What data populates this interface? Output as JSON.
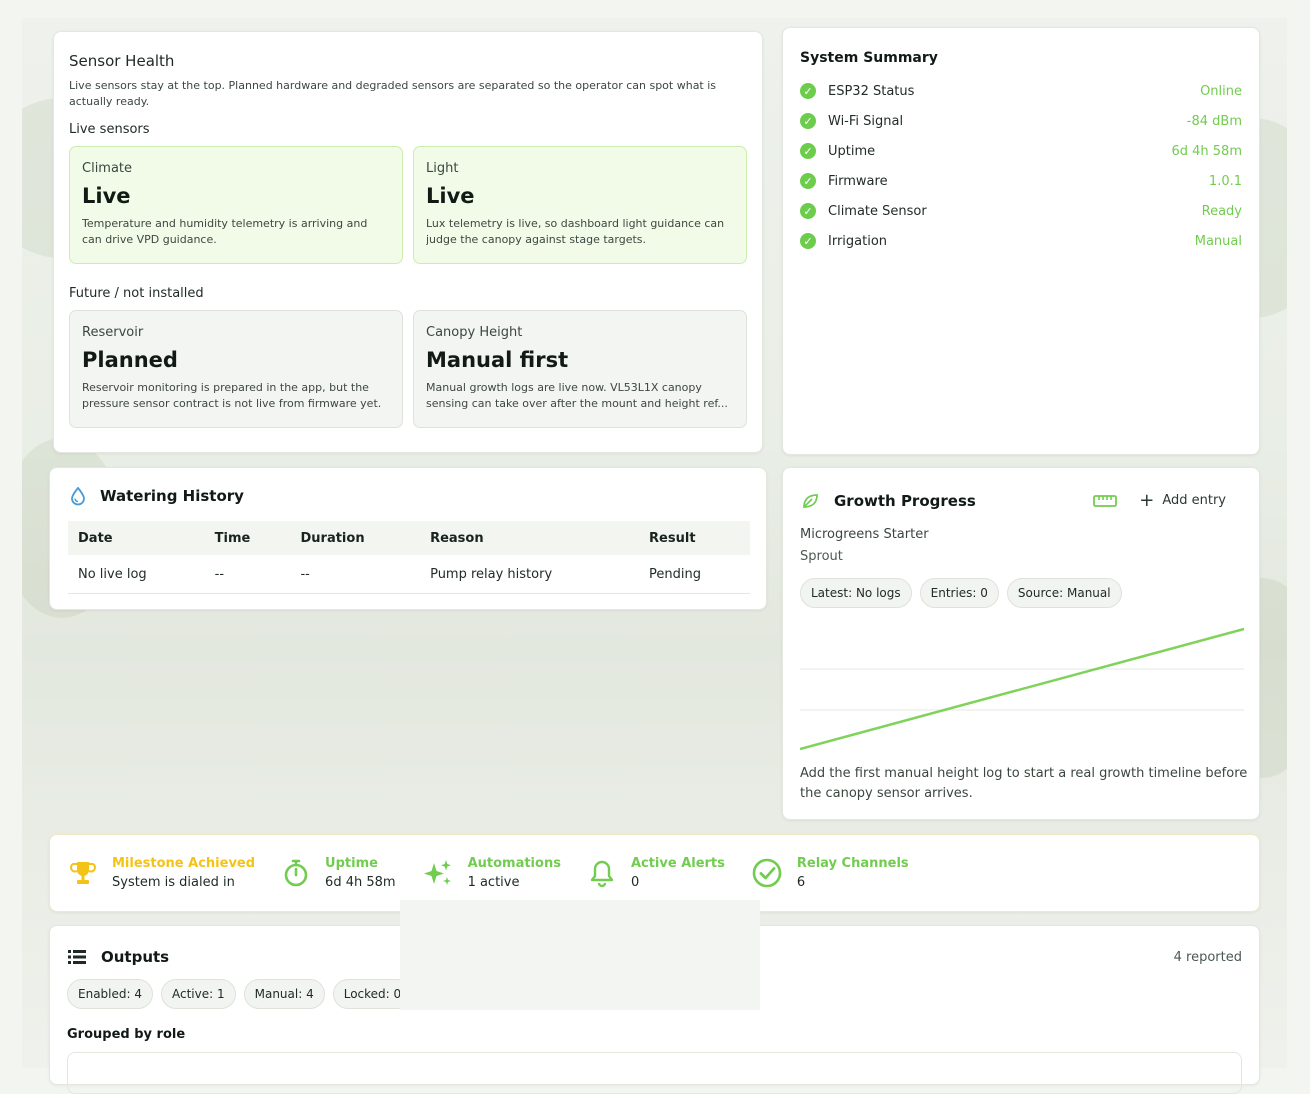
{
  "sensor_health": {
    "title": "Sensor Health",
    "description": "Live sensors stay at the top. Planned hardware and degraded sensors are separated so the operator can spot what is actually ready.",
    "live_label": "Live sensors",
    "future_label": "Future / not installed",
    "live": [
      {
        "name": "Climate",
        "status": "Live",
        "detail": "Temperature and humidity telemetry is arriving and can drive VPD guidance."
      },
      {
        "name": "Light",
        "status": "Live",
        "detail": "Lux telemetry is live, so dashboard light guidance can judge the canopy against stage targets."
      }
    ],
    "future": [
      {
        "name": "Reservoir",
        "status": "Planned",
        "detail": "Reservoir monitoring is prepared in the app, but the pressure sensor contract is not live from firmware yet."
      },
      {
        "name": "Canopy Height",
        "status": "Manual first",
        "detail": "Manual growth logs are live now. VL53L1X canopy sensing can take over after the mount and height ref..."
      }
    ]
  },
  "system_summary": {
    "title": "System Summary",
    "rows": [
      {
        "label": "ESP32 Status",
        "value": "Online"
      },
      {
        "label": "Wi-Fi Signal",
        "value": "-84 dBm"
      },
      {
        "label": "Uptime",
        "value": "6d 4h 58m"
      },
      {
        "label": "Firmware",
        "value": "1.0.1"
      },
      {
        "label": "Climate Sensor",
        "value": "Ready"
      },
      {
        "label": "Irrigation",
        "value": "Manual"
      }
    ]
  },
  "watering": {
    "title": "Watering History",
    "columns": [
      "Date",
      "Time",
      "Duration",
      "Reason",
      "Result"
    ],
    "rows": [
      [
        "No live log",
        "--",
        "--",
        "Pump relay history",
        "Pending"
      ]
    ]
  },
  "growth": {
    "title": "Growth Progress",
    "add_label": "Add entry",
    "plant": "Microgreens Starter",
    "stage": "Sprout",
    "pills": [
      "Latest: No logs",
      "Entries: 0",
      "Source: Manual"
    ],
    "note": "Add the first manual height log to start a real growth timeline before the canopy sensor arrives.",
    "line_color": "#7fd35a"
  },
  "chart_data": {
    "type": "line",
    "title": "",
    "xlabel": "",
    "ylabel": "",
    "grid": true,
    "x": [
      0,
      1
    ],
    "series": [
      {
        "values": [
          0,
          1
        ]
      }
    ],
    "ylim": [
      0,
      1
    ]
  },
  "stats": [
    {
      "label": "Milestone Achieved",
      "value": "System is dialed in",
      "color": "#f4c318",
      "icon": "trophy-icon"
    },
    {
      "label": "Uptime",
      "value": "6d 4h 58m",
      "color": "#72cc50",
      "icon": "stopwatch-icon"
    },
    {
      "label": "Automations",
      "value": "1 active",
      "color": "#72cc50",
      "icon": "sparkles-icon"
    },
    {
      "label": "Active Alerts",
      "value": "0",
      "color": "#72cc50",
      "icon": "bell-icon"
    },
    {
      "label": "Relay Channels",
      "value": "6",
      "color": "#72cc50",
      "icon": "check-circle-icon"
    }
  ],
  "outputs": {
    "title": "Outputs",
    "reported": "4 reported",
    "pills": [
      "Enabled: 4",
      "Active: 1",
      "Manual: 4",
      "Locked: 0"
    ],
    "group_label": "Grouped by role"
  }
}
